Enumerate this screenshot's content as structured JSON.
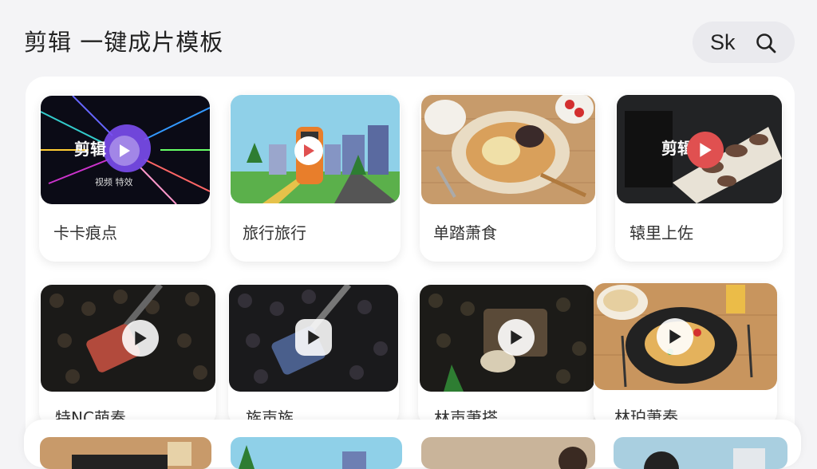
{
  "header": {
    "title": "剪辑  一键成片模板",
    "search_label": "Sk"
  },
  "templates": [
    {
      "label": "卡卡痕点",
      "thumb_text": "剪辑",
      "thumb_caption": "视频 特效"
    },
    {
      "label": "旅行旅行"
    },
    {
      "label": "单踏萧食"
    },
    {
      "label": "辕里上佐",
      "thumb_text": "剪辑"
    },
    {
      "label": "特NC萌奏"
    },
    {
      "label": "族声族"
    },
    {
      "label": "林声萧搭"
    },
    {
      "label": "林珀萧奏"
    }
  ],
  "colors": {
    "accent_purple": "#7b4cf0",
    "accent_red": "#e05050"
  }
}
